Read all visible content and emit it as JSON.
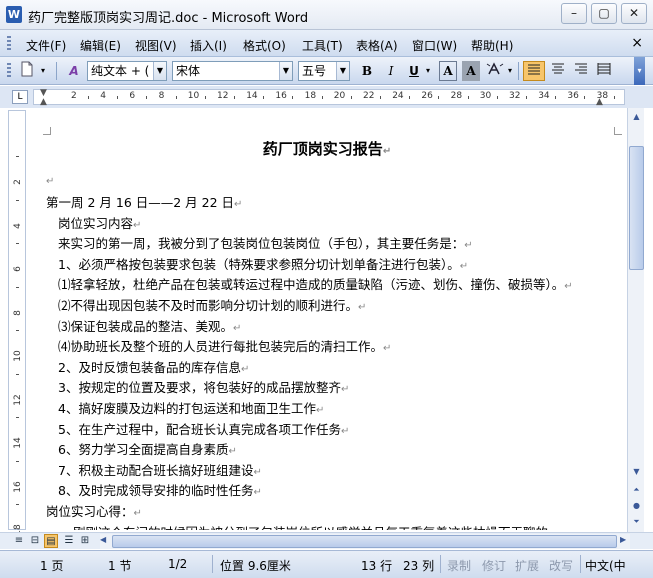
{
  "window": {
    "title": "药厂完整版顶岗实习周记.doc - Microsoft Word",
    "minimize": "–",
    "maximize": "▢",
    "close": "✕"
  },
  "menu": {
    "items": [
      "文件(F)",
      "编辑(E)",
      "视图(V)",
      "插入(I)",
      "格式(O)",
      "工具(T)",
      "表格(A)",
      "窗口(W)",
      "帮助(H)"
    ],
    "close_doc": "×"
  },
  "toolbar": {
    "style_value": "纯文本 + (",
    "font_value": "宋体",
    "size_value": "五号",
    "bold": "B",
    "italic": "I",
    "underline": "U"
  },
  "ruler": {
    "numbers": [
      "2",
      "4",
      "6",
      "8",
      "10",
      "12",
      "14",
      "16",
      "18",
      "20",
      "22",
      "24",
      "26",
      "28",
      "30",
      "32",
      "34",
      "36",
      "38"
    ],
    "vnumbers": [
      "2",
      "4",
      "6",
      "8",
      "10",
      "12",
      "14",
      "16",
      "18"
    ]
  },
  "document": {
    "title": "药厂顶岗实习报告",
    "lines": [
      "第一周 2 月 16 日——2 月 22 日",
      "岗位实习内容",
      "来实习的第一周，我被分到了包装岗位包装岗位（手包），其主要任务是：",
      "1、必须严格按包装要求包装（特殊要求参照分切计划单备注进行包装）。",
      "⑴轻拿轻放，杜绝产品在包装或转运过程中造成的质量缺陷（污迹、划伤、撞伤、破损等）。",
      "⑵不得出现因包装不及时而影响分切计划的顺利进行。",
      "⑶保证包装成品的整洁、美观。",
      "⑷协助班长及整个班的人员进行每批包装完后的清扫工作。",
      "2、及时反馈包装备品的库存信息",
      "3、按规定的位置及要求，将包装好的成品摆放整齐",
      "4、搞好废膜及边料的打包运送和地面卫生工作",
      "5、在生产过程中，配合班长认真完成各项工作任务",
      "6、努力学习全面提高自身素质",
      "7、积极主动配合班长搞好班组建设",
      "8、及时完成领导安排的临时性任务",
      "岗位实习心得：",
      "刚刚这个东间的时候因为被分到了包装岗位所以感觉并且每天重复着这些枯燥而无聊的"
    ],
    "paragraph_mark": "↵"
  },
  "status": {
    "page": "1 页",
    "section": "1 节",
    "page_of": "1/2",
    "position": "位置 9.6厘米",
    "line": "13 行",
    "column": "23 列",
    "rec": "录制",
    "trk": "修订",
    "ext": "扩展",
    "ovr": "改写",
    "language": "中文(中"
  },
  "colors": {
    "accent": "#f7c56a",
    "toolbar_blue": "#cfdcef",
    "app_icon": "#2a5db0"
  }
}
